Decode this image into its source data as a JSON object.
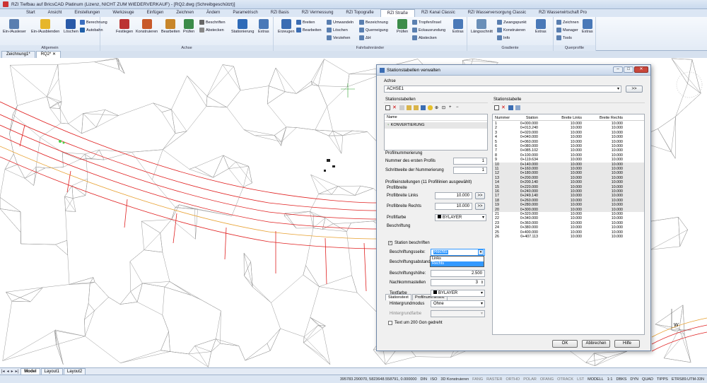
{
  "window": {
    "title": "RZI Tiefbau auf BricsCAD Platinum (Lizenz, NICHT ZUM WIEDERVERKAUF) - [RQ2.dwg (Schreibgeschützt)]"
  },
  "ribbon_tabs": [
    "Start",
    "Ansicht",
    "Einstellungen",
    "Werkzeuge",
    "Einfügen",
    "Zeichnen",
    "Ändern",
    "Parametrisch",
    "RZI Basis",
    "RZI Vermessung",
    "RZI Topografie",
    "RZI Straße",
    "RZI Kanal Classic",
    "RZI Wasserversorgung Classic",
    "RZI Wasserwirtschaft Pro"
  ],
  "active_ribbon_tab": "RZI Straße",
  "groups": {
    "allgemein": {
      "label": "Allgemein",
      "btn1": "Ein-/Ausleser",
      "btn2": "Ein-/Ausblenden",
      "btn3": "Löschen",
      "btn4": "Berechnung",
      "btn5": "Autobahn"
    },
    "achse": {
      "label": "Achse",
      "btn1": "Festlegen",
      "btn2": "Konstruieren",
      "btn3": "Bearbeiten",
      "btn4": "Prüfen",
      "btn5": "Beschriften",
      "btn6": "Abstecken",
      "btn7": "Stationierung",
      "btn8": "Extras"
    },
    "fahrbahnraender": {
      "label": "Fahrbahnränder",
      "btn1": "Erzeugen",
      "btn2": "Breiten",
      "btn3": "Bearbeiten",
      "btn4": "Umwandeln",
      "btn5": "Löschen",
      "btn6": "Verziehen",
      "btn7": "Bezeichnung",
      "btn8": "Querneigung",
      "btn9": "ΔH",
      "btn10": "Prüfen",
      "btn11": "Tropfen/Insel",
      "btn12": "Eckausrundung",
      "btn13": "Abstecken",
      "btn14": "Extras"
    },
    "gradiente": {
      "label": "Gradiente",
      "btn1": "Längsschnitt",
      "btn2": "Zwangspunkt",
      "btn3": "Konstruieren",
      "btn4": "Info",
      "btn5": "Extras"
    },
    "querprofile": {
      "label": "Querprofile",
      "btn1": "Zeichnen",
      "btn2": "Manager",
      "btn3": "Tools",
      "btn4": "Extras"
    }
  },
  "doc_tabs": [
    "Zeichnung1*",
    "RQ2*"
  ],
  "layout_tabs": [
    "Model",
    "Layout1",
    "Layout2"
  ],
  "status": {
    "coords": "395783.290070, 5823648.558791, 0.000000",
    "items": [
      "DIN",
      "ISO",
      "3D Konstruieren",
      "FANG",
      "RASTER",
      "ORTHO",
      "POLAR",
      "OFANG",
      "OTRACK",
      "LST",
      "MODELL",
      "1:1",
      "DBKS",
      "DYN",
      "QUAD",
      "TIPPS",
      "ETRS89.UTM-33N"
    ]
  },
  "dialog": {
    "title": "Stationstabellen verwalten",
    "achse_label": "Achse",
    "achse_value": "ACHSE1",
    "goto_btn": ">>",
    "stationstabellen_label": "Stationstabellen",
    "name_col": "Name",
    "table_item": "KONVERTIERUNG",
    "profilnummerierung_label": "Profilnummerierung",
    "nummer_label": "Nummer des ersten Profils",
    "nummer_value": "1",
    "schrittweite_label": "Schrittweite der Nummerierung",
    "schrittweite_value": "1",
    "profileinstellungen_label": "Profileinstellungen (11 Profillinien ausgewählt)",
    "profilbreite_label": "Profilbreite",
    "links_label": "Profilbreite Links",
    "links_value": "10.000",
    "rechts_label": "Profilbreite Rechts",
    "rechts_value": "10.000",
    "profilfarbe_label": "Profilfarbe",
    "profilfarbe_value": "BYLAYER",
    "beschriftung_label": "Beschriftung",
    "itab1": "Stationstext",
    "itab2": "Profilnummertext",
    "station_beschriften": "Station beschriften",
    "seite_label": "Beschriftungsseite:",
    "seite_value": "Rechts",
    "seite_options": [
      "Links",
      "Rechts"
    ],
    "abstand_label": "Beschriftungsabstand",
    "hoehe_label": "Beschriftungshöhe:",
    "hoehe_value": "2.500",
    "nachkomma_label": "Nachkommastellen",
    "nachkomma_value": "3",
    "textfarbe_label": "Textfarbe",
    "textfarbe_value": "BYLAYER",
    "hgmodus_label": "Hintergrundmodus",
    "hgmodus_value": "Ohne",
    "hgfarbe_label": "Hintergrundfarbe",
    "text200_label": "Text um 200 Gon gedreht",
    "stationstabelle_label": "Stationstabelle",
    "columns": [
      "Nummer",
      "Station",
      "Breite Links",
      "Breite Rechts"
    ],
    "rows": [
      [
        "1",
        "0+000.000",
        "10.000",
        "10.000"
      ],
      [
        "2",
        "0+013.240",
        "10.000",
        "10.000"
      ],
      [
        "3",
        "0+020.000",
        "10.000",
        "10.000"
      ],
      [
        "4",
        "0+040.000",
        "10.000",
        "10.000"
      ],
      [
        "5",
        "0+060.000",
        "10.000",
        "10.000"
      ],
      [
        "6",
        "0+080.000",
        "10.000",
        "10.000"
      ],
      [
        "7",
        "0+085.102",
        "10.000",
        "10.000"
      ],
      [
        "8",
        "0+100.000",
        "10.000",
        "10.000"
      ],
      [
        "9",
        "0+119.634",
        "10.000",
        "10.000"
      ],
      [
        "10",
        "0+140.000",
        "10.000",
        "10.000"
      ],
      [
        "11",
        "0+160.000",
        "10.000",
        "10.000"
      ],
      [
        "12",
        "0+180.000",
        "10.000",
        "10.000"
      ],
      [
        "13",
        "0+200.000",
        "10.000",
        "10.000"
      ],
      [
        "14",
        "0+200.140",
        "10.000",
        "10.000"
      ],
      [
        "15",
        "0+220.000",
        "10.000",
        "10.000"
      ],
      [
        "16",
        "0+240.000",
        "10.000",
        "10.000"
      ],
      [
        "17",
        "0+249.140",
        "10.000",
        "10.000"
      ],
      [
        "18",
        "0+260.000",
        "10.000",
        "10.000"
      ],
      [
        "19",
        "0+280.000",
        "10.000",
        "10.000"
      ],
      [
        "20",
        "0+300.000",
        "10.000",
        "10.000"
      ],
      [
        "21",
        "0+320.000",
        "10.000",
        "10.000"
      ],
      [
        "22",
        "0+340.000",
        "10.000",
        "10.000"
      ],
      [
        "23",
        "0+360.000",
        "10.000",
        "10.000"
      ],
      [
        "24",
        "0+380.000",
        "10.000",
        "10.000"
      ],
      [
        "25",
        "0+400.000",
        "10.000",
        "10.000"
      ],
      [
        "26",
        "0+407.113",
        "10.000",
        "10.000"
      ]
    ],
    "selected_rows_from": 10,
    "selected_rows_to": 20,
    "ok": "OK",
    "cancel": "Abbrechen",
    "help": "Hilfe"
  },
  "colors": {
    "accent": "#3399ff",
    "ribbon": "#e3ebf6",
    "alignment": "#e02020"
  }
}
